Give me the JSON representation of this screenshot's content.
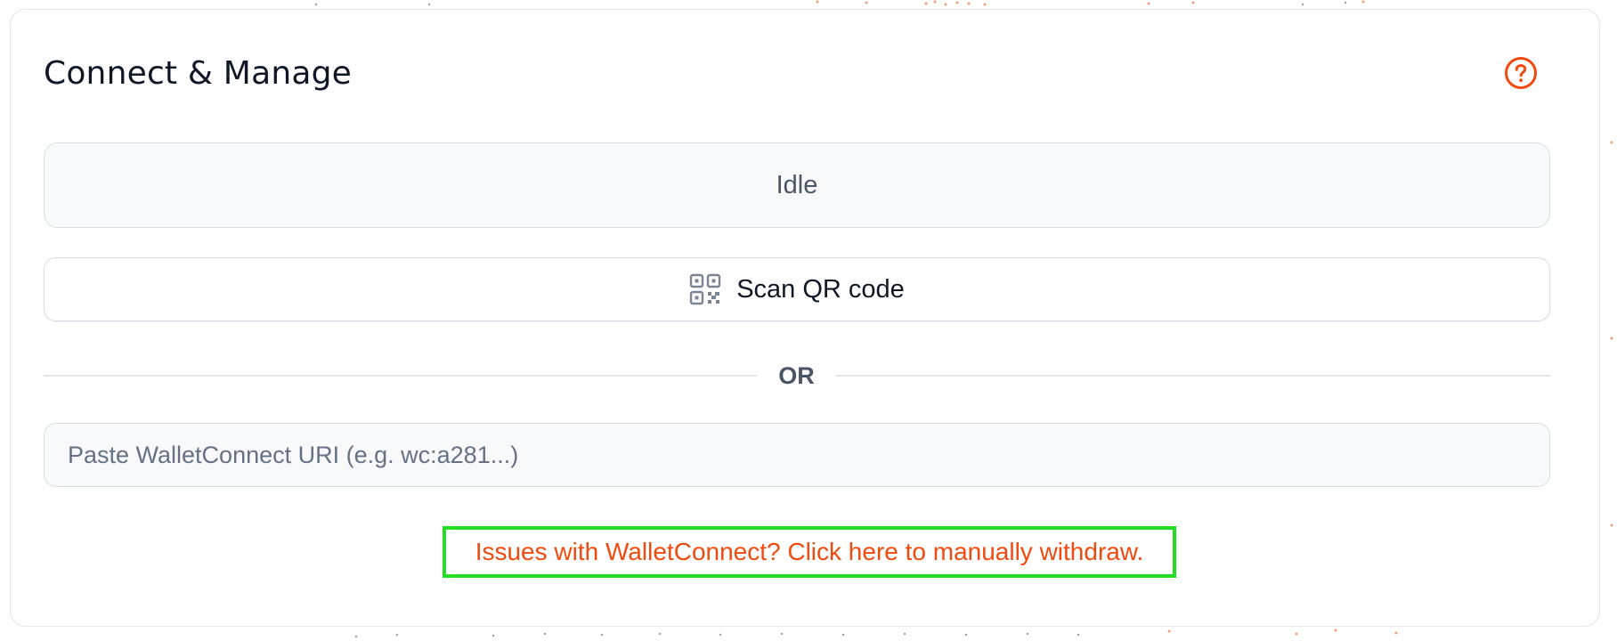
{
  "card": {
    "title": "Connect & Manage"
  },
  "help": {
    "icon": "help-circle-icon"
  },
  "status": {
    "text": "Idle"
  },
  "scan": {
    "icon": "qr-code-icon",
    "label": "Scan QR code"
  },
  "divider": {
    "text": "OR"
  },
  "uri": {
    "value": "",
    "placeholder": "Paste WalletConnect URI (e.g. wc:a281...)"
  },
  "withdraw": {
    "text": "Issues with WalletConnect? Click here to manually withdraw."
  },
  "colors": {
    "accent": "#f04a0f",
    "highlight_border": "#22dd22",
    "title": "#101828",
    "muted": "#4a5565"
  }
}
